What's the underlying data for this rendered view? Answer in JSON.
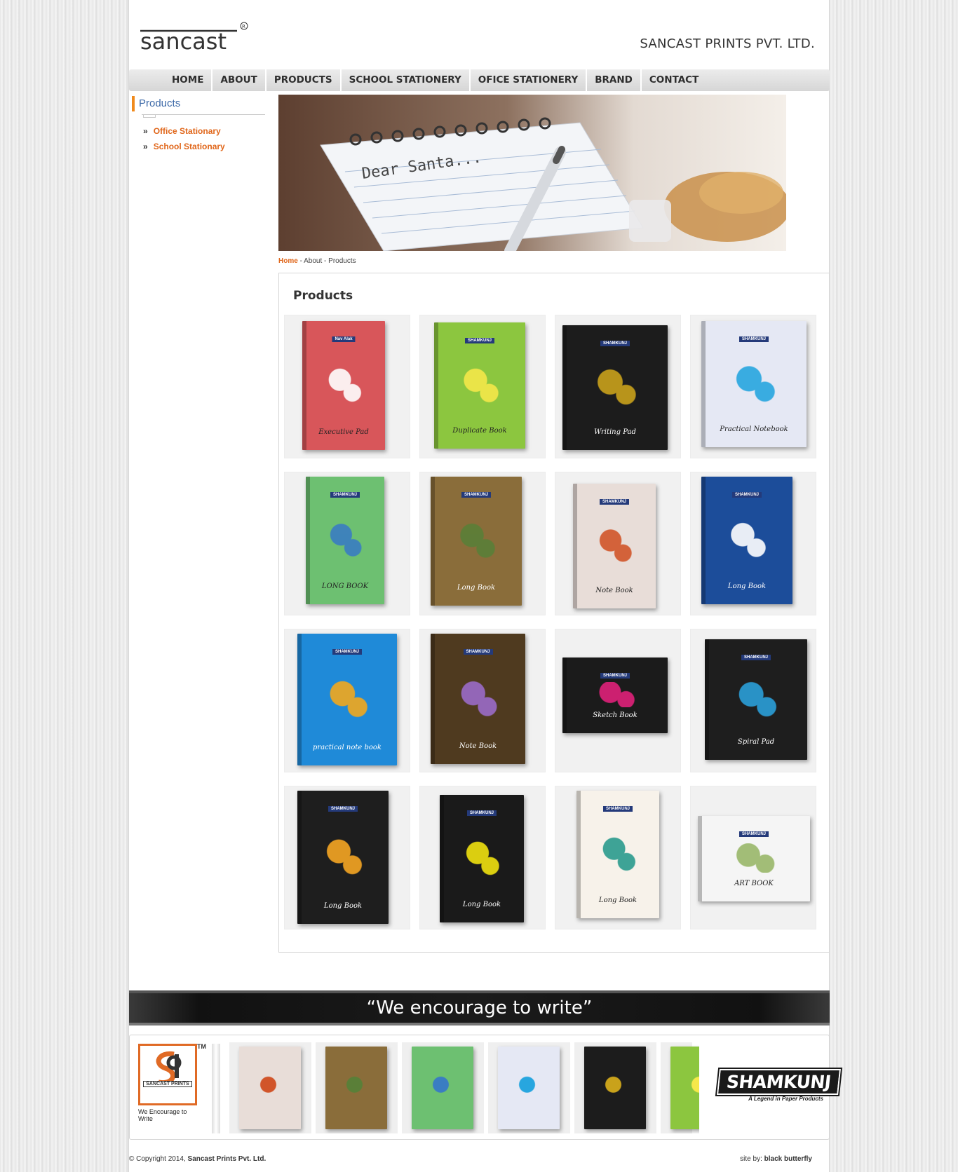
{
  "header": {
    "logo_text": "sancast",
    "company_name": "SANCAST PRINTS PVT. LTD."
  },
  "nav": {
    "items": [
      "HOME",
      "ABOUT",
      "PRODUCTS",
      "SCHOOL STATIONERY",
      "OFICE STATIONERY",
      "BRAND",
      "CONTACT"
    ]
  },
  "sidebar": {
    "title": "Products",
    "links": [
      "Office Stationary",
      "School Stationary"
    ],
    "bullet": "»"
  },
  "banner": {
    "caption": "Dear Santa..."
  },
  "breadcrumb": {
    "home": "Home",
    "sep": " - ",
    "about": "About",
    "products": "Products"
  },
  "products": {
    "title": "Products",
    "items": [
      {
        "cover": "#d8565a",
        "accent": "#ffffff",
        "label": "Executive Pad",
        "brand": "Nav Alak"
      },
      {
        "cover": "#8cc63f",
        "accent": "#f5e84a",
        "label": "Duplicate Book",
        "brand": "SHAMKUNJ"
      },
      {
        "cover": "#1c1c1c",
        "accent": "#c9a21b",
        "label": "Writing Pad",
        "brand": "SHAMKUNJ"
      },
      {
        "cover": "#e5e8f4",
        "accent": "#27a6df",
        "label": "Practical Notebook",
        "brand": "SHAMKUNJ"
      },
      {
        "cover": "#6dc071",
        "accent": "#3a7dc2",
        "label": "LONG BOOK",
        "brand": "SHAMKUNJ"
      },
      {
        "cover": "#8a6d3a",
        "accent": "#5a7f38",
        "label": "Long Book",
        "brand": "SHAMKUNJ"
      },
      {
        "cover": "#e8ddd8",
        "accent": "#d1552a",
        "label": "Note Book",
        "brand": "SHAMKUNJ"
      },
      {
        "cover": "#1c4d9a",
        "accent": "#ffffff",
        "label": "Long Book",
        "brand": "SHAMKUNJ"
      },
      {
        "cover": "#1f8ad8",
        "accent": "#f2a81d",
        "label": "practical note book",
        "brand": "SHAMKUNJ"
      },
      {
        "cover": "#4f3a1f",
        "accent": "#9b6cc8",
        "label": "Note Book",
        "brand": "SHAMKUNJ"
      },
      {
        "cover": "#1b1b1b",
        "accent": "#e0217a",
        "label": "Sketch Book",
        "brand": "SHAMKUNJ"
      },
      {
        "cover": "#1e1e1e",
        "accent": "#2b9fd9",
        "label": "Spiral Pad",
        "brand": "SHAMKUNJ"
      },
      {
        "cover": "#1e1e1e",
        "accent": "#f5a623",
        "label": "Long Book",
        "brand": "SHAMKUNJ"
      },
      {
        "cover": "#1a1a1a",
        "accent": "#f0e20f",
        "label": "Long Book",
        "brand": "SHAMKUNJ"
      },
      {
        "cover": "#f7f2ea",
        "accent": "#2b9b8d",
        "label": "Long Book",
        "brand": "SHAMKUNJ"
      },
      {
        "cover": "#f5f5f5",
        "accent": "#9ab86a",
        "label": "ART BOOK",
        "brand": "SHAMKUNJ"
      }
    ]
  },
  "footer": {
    "tagline": "“We encourage to write”",
    "sancast_logo_name": "SANCAST PRINTS",
    "sancast_tm": "TM",
    "sancast_tag": "We Encourage to Write",
    "shamkunj_name": "SHAMKUNJ",
    "shamkunj_tag": "A Legend in Paper Products",
    "copyright_prefix": "© Copyright 2014, ",
    "copyright_company": "Sancast Prints Pvt. Ltd.",
    "site_prefix": "site by: ",
    "site_by": "black butterfly"
  },
  "colors": {
    "accent_orange": "#e0661a",
    "sidebar_title_blue": "#3e6aa8",
    "nav_bg": "#dcdcdc"
  }
}
